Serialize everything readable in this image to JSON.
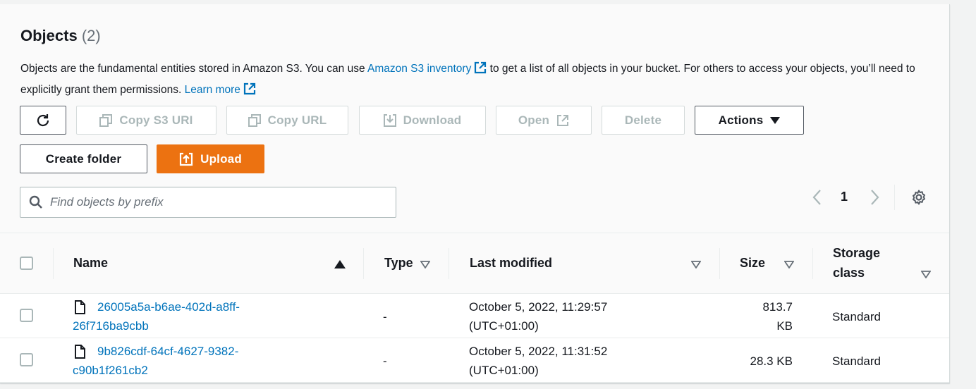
{
  "header": {
    "title": "Objects",
    "count": "(2)"
  },
  "description": {
    "part1": "Objects are the fundamental entities stored in Amazon S3. You can use ",
    "link1": "Amazon S3 inventory",
    "part2": " to get a list of all objects in your bucket. For others to access your objects, you’ll need to explicitly grant them permissions. ",
    "link2": "Learn more"
  },
  "toolbar": {
    "refresh_icon": "refresh-icon",
    "copy_s3_uri": "Copy S3 URI",
    "copy_url": "Copy URL",
    "download": "Download",
    "open": "Open",
    "delete": "Delete",
    "actions": "Actions",
    "create_folder": "Create folder",
    "upload": "Upload"
  },
  "search": {
    "placeholder": "Find objects by prefix",
    "value": ""
  },
  "pagination": {
    "current_page": "1"
  },
  "table": {
    "columns": {
      "name": "Name",
      "type": "Type",
      "last_modified": "Last modified",
      "size": "Size",
      "storage_class_line1": "Storage",
      "storage_class_line2": "class"
    },
    "rows": [
      {
        "name_line1": "26005a5a-b6ae-402d-a8ff-",
        "name_line2": "26f716ba9cbb",
        "type": "-",
        "modified_line1": "October 5, 2022, 11:29:57",
        "modified_line2": "(UTC+01:00)",
        "size_line1": "813.7",
        "size_line2": "KB",
        "storage_class": "Standard"
      },
      {
        "name_line1": "9b826cdf-64cf-4627-9382-",
        "name_line2": "c90b1f261cb2",
        "type": "-",
        "modified_line1": "October 5, 2022, 11:31:52",
        "modified_line2": "(UTC+01:00)",
        "size_line1": "28.3 KB",
        "size_line2": "",
        "storage_class": "Standard"
      }
    ]
  },
  "colors": {
    "accent_orange": "#ec7211",
    "link_blue": "#0073bb",
    "disabled_text": "#aab7b8"
  }
}
